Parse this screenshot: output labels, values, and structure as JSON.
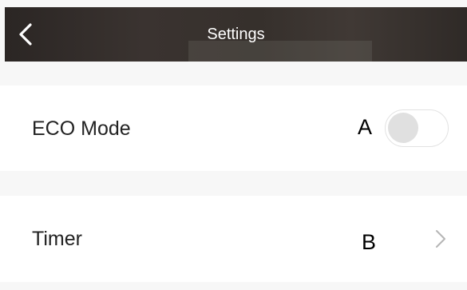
{
  "header": {
    "title": "Settings",
    "back_icon": "chevron-left-icon"
  },
  "rows": [
    {
      "label": "ECO Mode",
      "marker": "A",
      "control": "toggle",
      "toggle_on": false
    },
    {
      "label": "Timer",
      "marker": "B",
      "control": "chevron-right-icon"
    }
  ],
  "colors": {
    "header_bg": "#332d2a",
    "page_bg": "#f7f7f7",
    "row_bg": "#ffffff",
    "toggle_knob": "#e0e0e0",
    "chevron": "#b5b5b5"
  }
}
